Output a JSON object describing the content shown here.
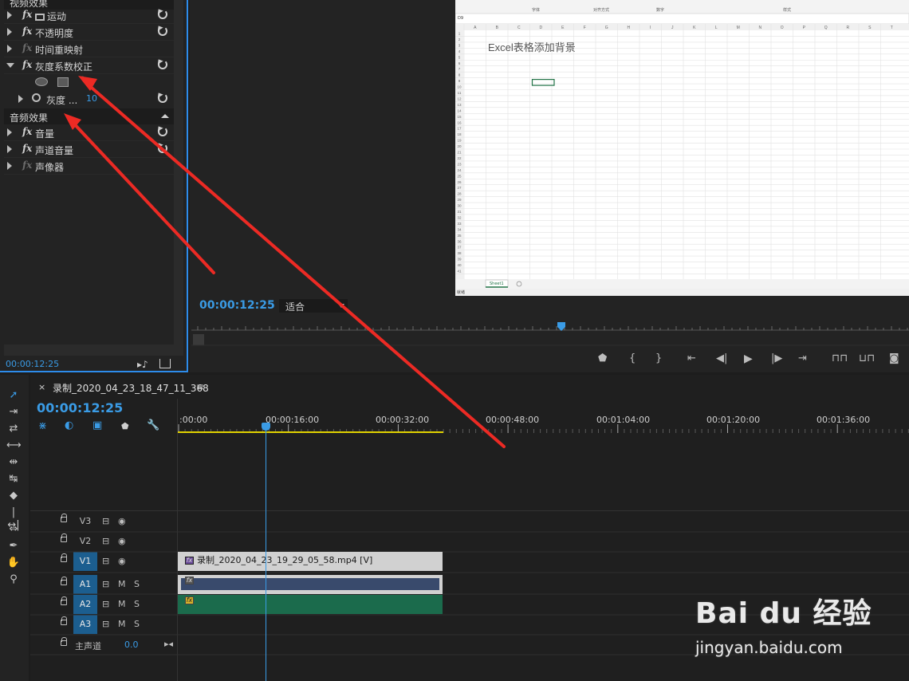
{
  "effects_panel": {
    "section_video": "视频效果",
    "rows": [
      {
        "label": "运动"
      },
      {
        "label": "不透明度"
      },
      {
        "label": "时间重映射"
      },
      {
        "label": "灰度系数校正"
      },
      {
        "label": "灰度 ..."
      }
    ],
    "param_value": "10",
    "section_audio": "音频效果",
    "audio_rows": [
      {
        "label": "音量"
      },
      {
        "label": "声道音量"
      },
      {
        "label": "声像器"
      }
    ],
    "timecode": "00:00:12:25"
  },
  "program_monitor": {
    "timecode": "00:00:12:25",
    "fit_label": "适合",
    "excel": {
      "title_text": "Excel表格添加背景",
      "name_box": "D9",
      "sheet_tab": "Sheet1",
      "ribbon_groups": [
        "字体",
        "对齐方式",
        "数字",
        "样式"
      ],
      "columns": [
        "A",
        "B",
        "C",
        "D",
        "E",
        "F",
        "G",
        "H",
        "I",
        "J",
        "K",
        "L",
        "M",
        "N",
        "O",
        "P",
        "Q",
        "R",
        "S",
        "T"
      ],
      "row_count": 41,
      "status_text": "就绪"
    }
  },
  "timeline": {
    "sequence_name": "录制_2020_04_23_18_47_11_368",
    "timecode": "00:00:12:25",
    "ticks": [
      ":00:00",
      "00:00:16:00",
      "00:00:32:00",
      "00:00:48:00",
      "00:01:04:00",
      "00:01:20:00",
      "00:01:36:00"
    ],
    "tracks": [
      {
        "name": "V3",
        "i2": "◉"
      },
      {
        "name": "V2",
        "i2": "◉"
      },
      {
        "name": "V1",
        "i2": "◉"
      },
      {
        "name": "A1",
        "i2": "M",
        "i3": "S"
      },
      {
        "name": "A2",
        "i2": "M",
        "i3": "S"
      },
      {
        "name": "A3",
        "i2": "M",
        "i3": "S"
      }
    ],
    "master_label": "主声道",
    "master_value": "0.0",
    "video_clip": "录制_2020_04_23_19_29_05_58.mp4 [V]"
  },
  "watermark": {
    "brand": "Bai du 经验",
    "url": "jingyan.baidu.com"
  },
  "colors": {
    "accent": "#3a9be5",
    "arrow": "#ec2a24",
    "audio_a1": "#394a6c",
    "audio_a2": "#1b6b4c",
    "video_clip": "#d1d1d1",
    "track_active": "#1c5e8f"
  }
}
